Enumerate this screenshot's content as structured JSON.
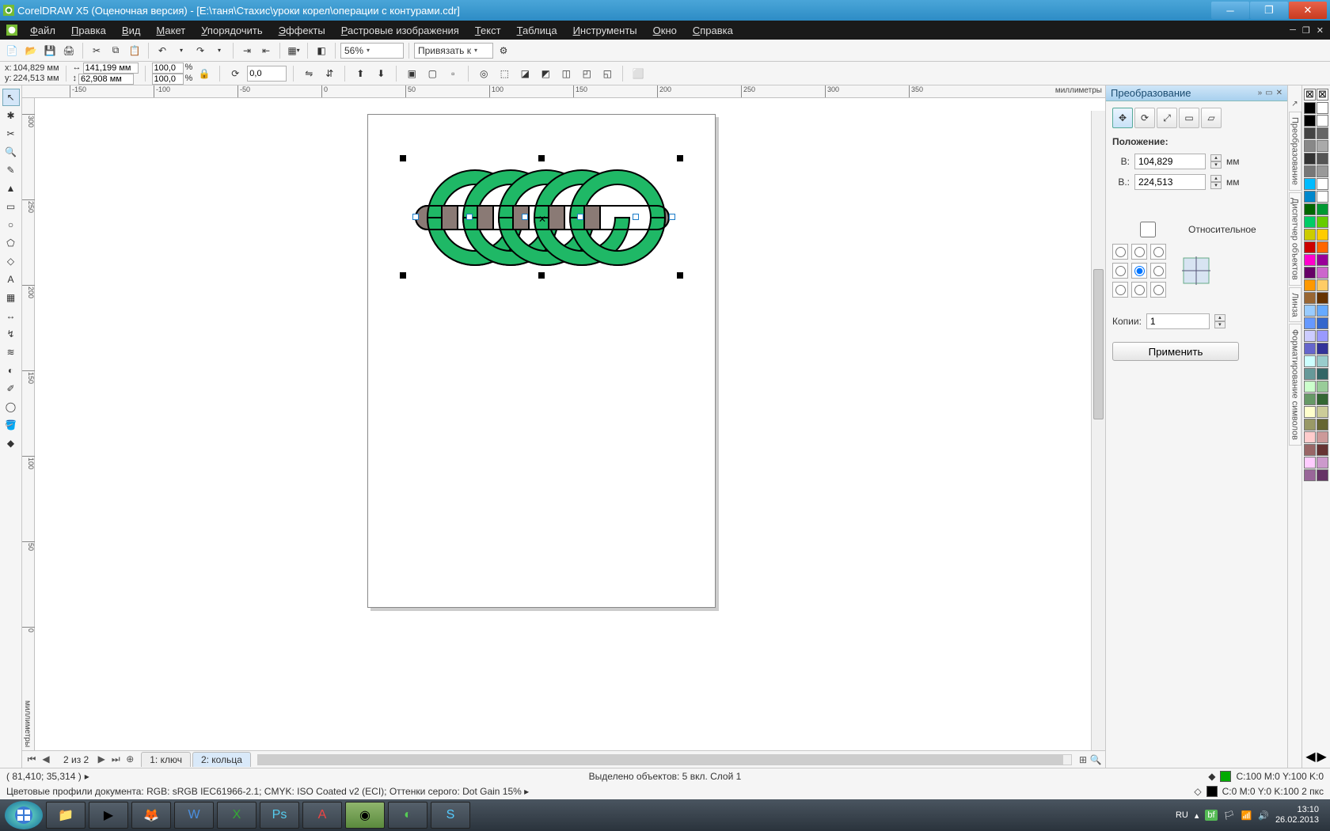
{
  "title": "CorelDRAW X5 (Оценочная версия) - [E:\\таня\\Стахис\\уроки корел\\операции с контурами.cdr]",
  "menu": [
    "Файл",
    "Правка",
    "Вид",
    "Макет",
    "Упорядочить",
    "Эффекты",
    "Растровые изображения",
    "Текст",
    "Таблица",
    "Инструменты",
    "Окно",
    "Справка"
  ],
  "toolbar": {
    "zoom": "56%",
    "snap": "Привязать к"
  },
  "prop": {
    "x": "104,829 мм",
    "y": "224,513 мм",
    "w": "141,199 мм",
    "h": "62,908 мм",
    "sx": "100,0",
    "sy": "100,0",
    "rot": "0,0"
  },
  "ruler_unit": "миллиметры",
  "ruler_h": [
    "-150",
    "-100",
    "-50",
    "0",
    "50",
    "100",
    "150",
    "200",
    "250",
    "300",
    "350"
  ],
  "ruler_v": [
    "300",
    "250",
    "200",
    "150",
    "100",
    "50",
    "0"
  ],
  "tabs": {
    "page_info": "2 из 2",
    "tab1": "1: ключ",
    "tab2": "2: кольца"
  },
  "docker": {
    "title": "Преобразование",
    "pos_label": "Положение:",
    "x_label": "В:",
    "x_val": "104,829",
    "y_label": "В.:",
    "y_val": "224,513",
    "mm": "мм",
    "relative": "Относительное",
    "copies_label": "Копии:",
    "copies_val": "1",
    "apply": "Применить"
  },
  "vtabs": [
    "Преобразование",
    "Диспетчер объектов",
    "Линза",
    "Форматирование символов"
  ],
  "status": {
    "coord": "( 81,410; 35,314 )",
    "selection": "Выделено объектов: 5 вкл. Слой 1",
    "fill": "C:100 M:0 Y:100 K:0",
    "outline": "C:0 M:0 Y:0 K:100  2 пкс",
    "none_sw": "⊘"
  },
  "profile": "Цветовые профили документа: RGB: sRGB IEC61966-2.1; CMYK: ISO Coated v2 (ECI); Оттенки серого: Dot Gain 15% ▸",
  "tray": {
    "lang": "RU",
    "time": "13:10",
    "date": "26.02.2013"
  },
  "palette_colors": [
    "#000",
    "#fff",
    "#000",
    "#fff",
    "#444",
    "#666",
    "#888",
    "#aaa",
    "#333",
    "#555",
    "#777",
    "#999",
    "#0bf",
    "#fff",
    "#08c",
    "#fff",
    "#060",
    "#093",
    "#0c6",
    "#6c0",
    "#cc0",
    "#fc0",
    "#c00",
    "#f60",
    "#f0c",
    "#909",
    "#606",
    "#c6c",
    "#f90",
    "#fc6",
    "#963",
    "#630",
    "#9cf",
    "#6af",
    "#69f",
    "#36c",
    "#ccf",
    "#99f",
    "#66c",
    "#339",
    "#cff",
    "#9cc",
    "#699",
    "#366",
    "#cfc",
    "#9c9",
    "#696",
    "#363",
    "#ffc",
    "#cc9",
    "#996",
    "#663",
    "#fcc",
    "#c99",
    "#966",
    "#633",
    "#fcf",
    "#c9c",
    "#969",
    "#636"
  ]
}
